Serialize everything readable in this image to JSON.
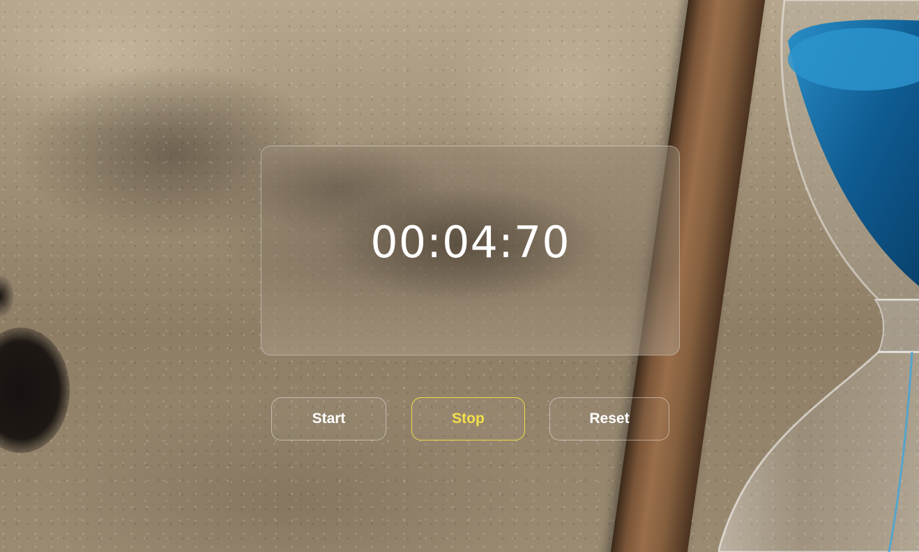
{
  "timer": {
    "display": "00:04:70"
  },
  "controls": {
    "start_label": "Start",
    "stop_label": "Stop",
    "reset_label": "Reset"
  },
  "colors": {
    "active_accent": "#f3e04a",
    "text": "#ffffff"
  }
}
